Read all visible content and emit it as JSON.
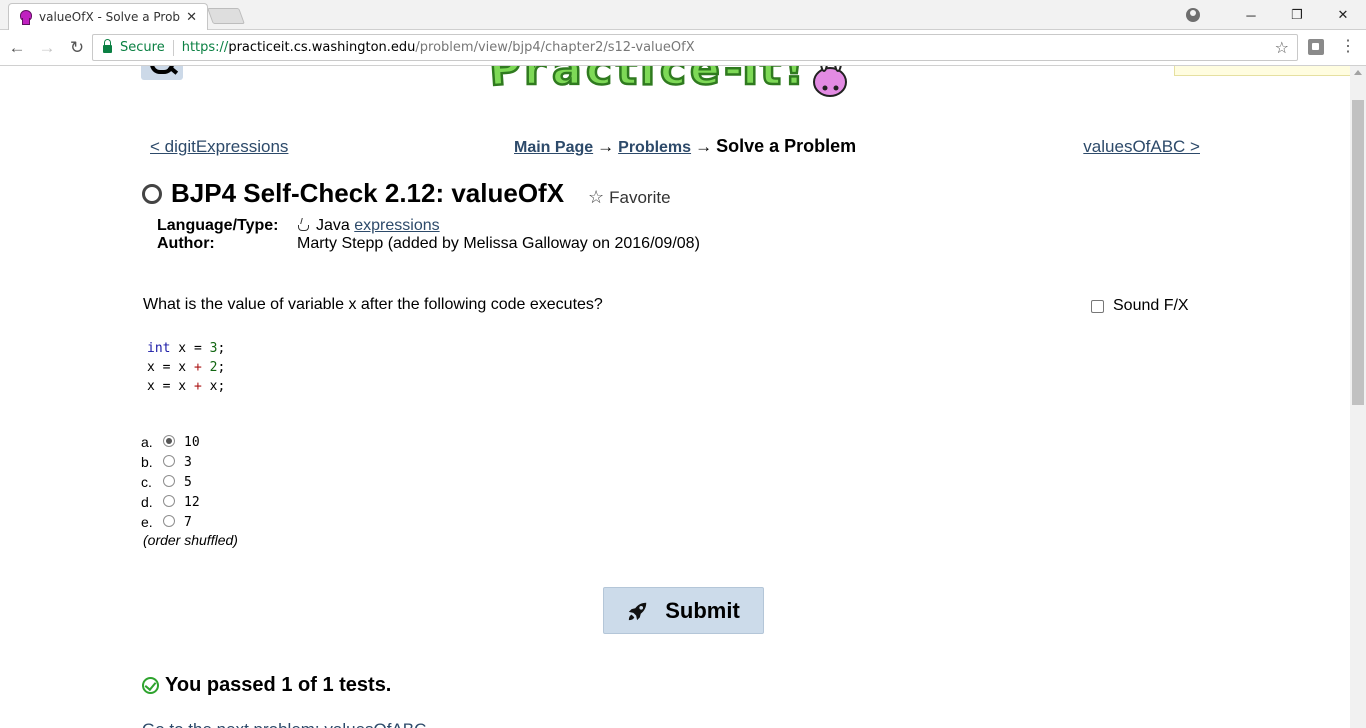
{
  "browser": {
    "tab_title": "valueOfX - Solve a Proble",
    "secure_label": "Secure",
    "url_scheme": "https://",
    "url_host": "practiceit.cs.washington.edu",
    "url_path": "/problem/view/bjp4/chapter2/s12-valueOfX",
    "icons": [
      "back-icon",
      "forward-icon",
      "reload-icon",
      "lock-icon",
      "star-icon",
      "extension-icon",
      "menu-icon",
      "profile-icon"
    ]
  },
  "page": {
    "prev_link": "< digitExpressions",
    "next_link": "valuesOfABC >",
    "breadcrumb": {
      "main": "Main Page",
      "problems": "Problems",
      "current": "Solve a Problem",
      "arrow": "→"
    },
    "title": "BJP4 Self-Check 2.12: valueOfX",
    "favorite_label": "Favorite",
    "meta": {
      "language_key": "Language/Type:",
      "language_value": "Java",
      "language_link": "expressions",
      "author_key": "Author:",
      "author_value": "Marty Stepp (added by Melissa Galloway on 2016/09/08)"
    },
    "question": "What is the value of variable x after the following code executes?",
    "sound_fx_label": "Sound F/X",
    "code": {
      "line1": {
        "kw": "int",
        "text": " x = ",
        "num": "3",
        "end": ";"
      },
      "line2": "x = x + 2;",
      "line3": "x = x + x;"
    },
    "answers": [
      {
        "letter": "a.",
        "value": "10",
        "checked": true
      },
      {
        "letter": "b.",
        "value": "3",
        "checked": false
      },
      {
        "letter": "c.",
        "value": "5",
        "checked": false
      },
      {
        "letter": "d.",
        "value": "12",
        "checked": false
      },
      {
        "letter": "e.",
        "value": "7",
        "checked": false
      }
    ],
    "order_note": "(order shuffled)",
    "submit_label": "Submit",
    "result": "You passed 1 of 1 tests.",
    "next_problem_link": "Go to the next problem: valuesOfABC"
  },
  "colors": {
    "link": "#2d4a6a",
    "secure_green": "#0b8043",
    "submit_bg": "#ccdbea",
    "pass_green": "#2ea32e"
  }
}
